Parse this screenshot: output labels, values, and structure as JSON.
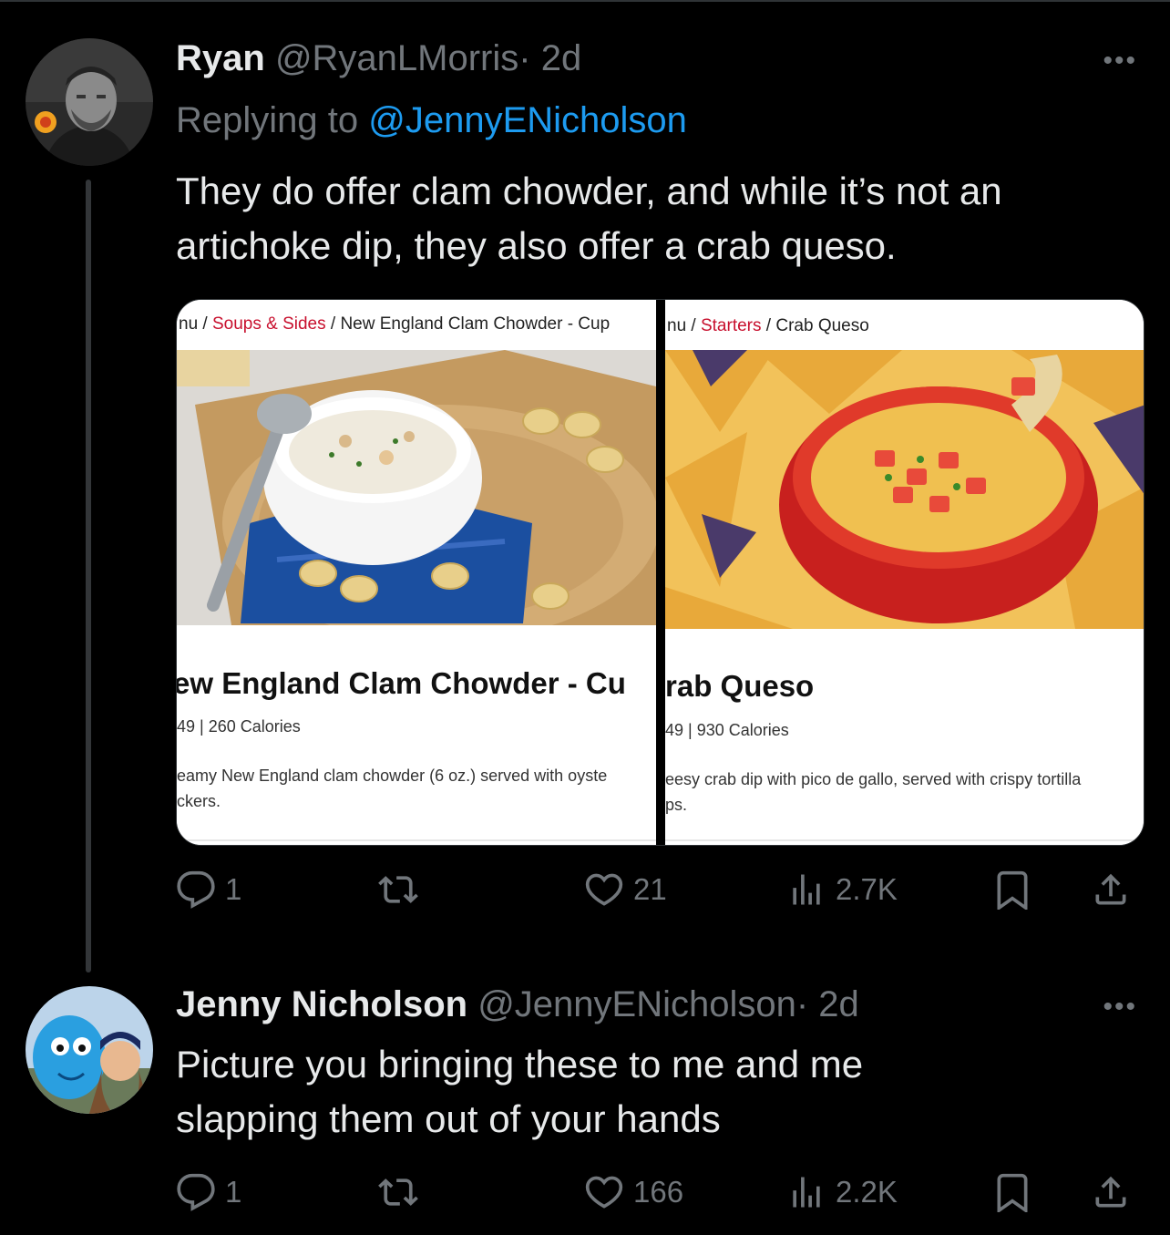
{
  "tweets": [
    {
      "name": "Ryan",
      "handle": "@RyanLMorris",
      "time": "· 2d",
      "replying_prefix": "Replying to",
      "replying_to": "@JennyENicholson",
      "text": "They do offer clam chowder, and while it’s not an artichoke dip, they also offer a crab queso.",
      "media": {
        "left": {
          "crumb_prefix": "nu /",
          "crumb_section": "Soups & Sides",
          "crumb_item": "/ New England Clam Chowder - Cup",
          "title": "ew England Clam Chowder - Cu",
          "calories": "49 | 260 Calories",
          "desc_line1": "eamy New England clam chowder (6 oz.) served with oyste",
          "desc_line2": "ckers."
        },
        "right": {
          "crumb_prefix": "nu /",
          "crumb_section": "Starters",
          "crumb_item": "/ Crab Queso",
          "title": "rab Queso",
          "calories": "49 | 930 Calories",
          "desc_line1": "eesy crab dip with pico de gallo, served with crispy tortilla",
          "desc_line2": "ps."
        }
      },
      "actions": {
        "replies": "1",
        "retweets": "",
        "likes": "21",
        "views": "2.7K"
      }
    },
    {
      "name": "Jenny Nicholson",
      "handle": "@JennyENicholson",
      "time": "· 2d",
      "text_line1": "Picture you bringing these to me and me",
      "text_line2": "slapping them out of your hands",
      "actions": {
        "replies": "1",
        "retweets": "",
        "likes": "166",
        "views": "2.2K"
      }
    }
  ],
  "more_symbol": "•••",
  "colors": {
    "background": "#000000",
    "text": "#e7e9ea",
    "muted": "#71767b",
    "link": "#1d9bf0",
    "crumb_red": "#c8102e"
  },
  "icons": [
    "reply-icon",
    "retweet-icon",
    "like-icon",
    "views-icon",
    "bookmark-icon",
    "share-icon",
    "more-icon"
  ]
}
